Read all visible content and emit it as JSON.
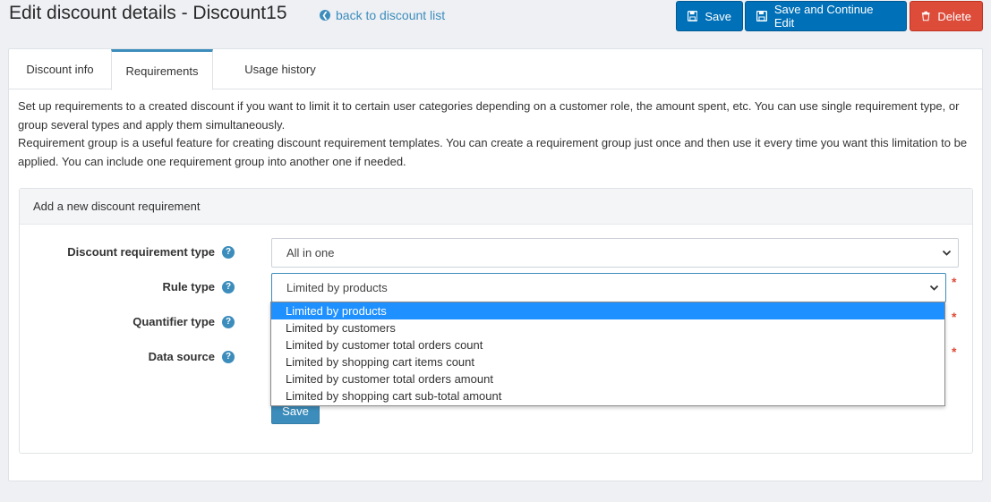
{
  "header": {
    "title": "Edit discount details - Discount15",
    "back_link": "back to discount list",
    "buttons": {
      "save": "Save",
      "save_continue": "Save and Continue Edit",
      "delete": "Delete"
    }
  },
  "tabs": [
    {
      "label": "Discount info"
    },
    {
      "label": "Requirements"
    },
    {
      "label": "Usage history"
    }
  ],
  "intro": {
    "line1": "Set up requirements to a created discount if you want to limit it to certain user categories depending on a customer role, the amount spent, etc. You can use single requirement type, or group several types and apply them simultaneously.",
    "line2": "Requirement group is a useful feature for creating discount requirement templates. You can create a requirement group just once and then use it every time you want this limitation to be applied. You can include one requirement group into another one if needed."
  },
  "box": {
    "title": "Add a new discount requirement",
    "fields": {
      "requirement_type": {
        "label": "Discount requirement type",
        "value": "All in one"
      },
      "rule_type": {
        "label": "Rule type",
        "value": "Limited by products"
      },
      "quantifier_type": {
        "label": "Quantifier type"
      },
      "data_source": {
        "label": "Data source"
      }
    },
    "required_mark": "*",
    "save": "Save"
  },
  "dropdown": {
    "options": [
      "Limited by products",
      "Limited by customers",
      "Limited by customer total orders count",
      "Limited by shopping cart items count",
      "Limited by customer total orders amount",
      "Limited by shopping cart sub-total amount"
    ],
    "selected": "Limited by products"
  },
  "colors": {
    "primary": "#0070b8",
    "danger": "#dd4b39",
    "link": "#3c8dbc",
    "selected_option": "#1e90ff"
  },
  "icons": {
    "back": "arrow-circle-left-icon",
    "save": "floppy-disk-icon",
    "delete": "trash-icon",
    "help": "question-circle-icon",
    "chevron": "chevron-down-icon"
  }
}
